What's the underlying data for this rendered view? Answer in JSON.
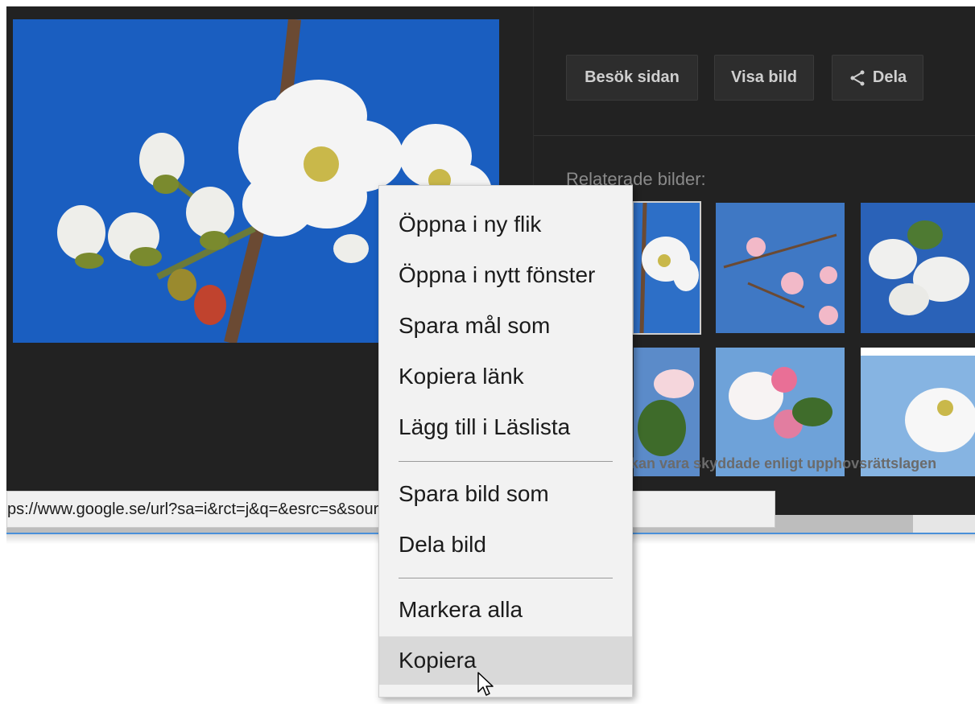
{
  "actions": {
    "visit_label": "Besök sidan",
    "view_label": "Visa bild",
    "share_label": "Dela",
    "share_icon": "share-icon"
  },
  "related": {
    "label": "Relaterade bilder:",
    "copyright_note": "kan vara skyddade enligt upphovsrättslagen"
  },
  "status_bar": {
    "url_text": "ps://www.google.se/url?sa=i&rct=j&q=&esrc=s&source=images&cd=&cad=rja&uact=8&"
  },
  "context_menu": {
    "items": [
      {
        "label": "Öppna i ny flik"
      },
      {
        "label": "Öppna i nytt fönster"
      },
      {
        "label": "Spara mål som"
      },
      {
        "label": "Kopiera länk"
      },
      {
        "label": "Lägg till i Läslista"
      },
      {
        "label": "Spara bild som"
      },
      {
        "label": "Dela bild"
      },
      {
        "label": "Markera alla"
      },
      {
        "label": "Kopiera"
      }
    ],
    "hovered_item": "Kopiera"
  },
  "colors": {
    "viewer_bg": "#222222",
    "sky_blue": "#1a5ec0",
    "menu_bg": "#f2f2f2",
    "menu_hover": "#d9d9d9",
    "accent_line": "#4a90d9"
  }
}
